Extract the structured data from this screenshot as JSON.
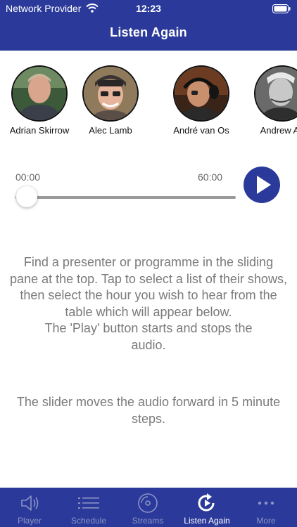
{
  "status_bar": {
    "carrier": "Network Provider",
    "time": "12:23"
  },
  "header": {
    "title": "Listen Again"
  },
  "presenters": [
    {
      "name": "Adrian Skirrow"
    },
    {
      "name": "Alec Lamb"
    },
    {
      "name": "André van Os"
    },
    {
      "name": "Andrew Au"
    }
  ],
  "player": {
    "elapsed": "00:00",
    "duration": "60:00",
    "position_fraction": 0
  },
  "instructions": {
    "main": "Find a presenter or programme in the sliding pane at the top. Tap to select a list of their shows, then select the hour you wish to hear from the table which will appear below.",
    "play_note": "The 'Play' button starts and stops the audio.",
    "slider_note": "The slider moves the audio forward in 5 minute steps."
  },
  "tab_bar": {
    "items": [
      {
        "label": "Player",
        "icon": "speaker-icon"
      },
      {
        "label": "Schedule",
        "icon": "list-icon"
      },
      {
        "label": "Streams",
        "icon": "disc-icon"
      },
      {
        "label": "Listen Again",
        "icon": "replay-icon",
        "active": true
      },
      {
        "label": "More",
        "icon": "more-icon"
      }
    ]
  },
  "colors": {
    "brand": "#2b3a9a",
    "tab_inactive": "#8c93c4",
    "text_muted": "#7a7a7a"
  }
}
